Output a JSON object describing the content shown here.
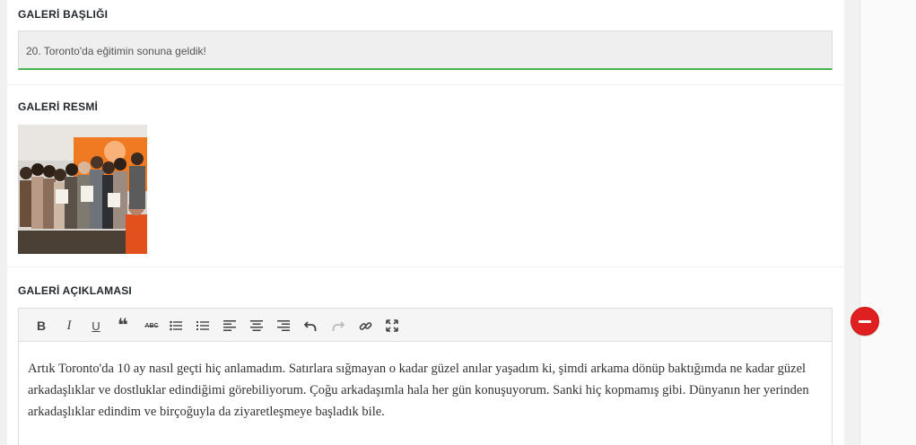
{
  "gallery_title": {
    "label": "GALERİ BAŞLIĞI",
    "value": "20. Toronto'da eğitimin sonuna geldik!"
  },
  "gallery_image": {
    "label": "GALERİ RESMİ",
    "alt": "group-photo"
  },
  "gallery_description": {
    "label": "GALERİ AÇIKLAMASI",
    "toolbar": [
      {
        "name": "bold-button",
        "icon": "B"
      },
      {
        "name": "italic-button",
        "icon": "I"
      },
      {
        "name": "underline-button",
        "icon": "U"
      },
      {
        "name": "blockquote-button",
        "icon": "❝"
      },
      {
        "name": "strikethrough-button",
        "icon": "ABC"
      },
      {
        "name": "bullet-list-button",
        "icon": "list-ul"
      },
      {
        "name": "numbered-list-button",
        "icon": "list-ol"
      },
      {
        "name": "align-left-button",
        "icon": "align-left"
      },
      {
        "name": "align-center-button",
        "icon": "align-center"
      },
      {
        "name": "align-right-button",
        "icon": "align-right"
      },
      {
        "name": "undo-button",
        "icon": "undo"
      },
      {
        "name": "redo-button",
        "icon": "redo"
      },
      {
        "name": "link-button",
        "icon": "link"
      },
      {
        "name": "fullscreen-button",
        "icon": "expand"
      }
    ],
    "text": "Artık Toronto'da 10 ay nasıl geçti hiç anlamadım. Satırlara sığmayan o kadar güzel anılar yaşadım ki, şimdi arkama dönüp baktığımda ne kadar güzel arkadaşlıklar ve dostluklar edindiğimi görebiliyorum. Çoğu arkadaşımla hala her gün konuşuyorum. Sanki hiç kopmamış gibi. Dünyanın her yerinden arkadaşlıklar edindim ve birçoğuyla da ziyaretleşmeye başladık bile."
  },
  "colors": {
    "accent_green": "#46b450",
    "remove_red": "#e02020"
  }
}
